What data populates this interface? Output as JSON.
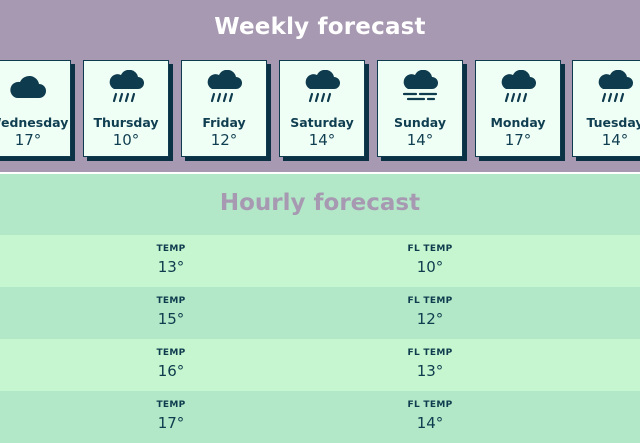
{
  "weekly": {
    "title": "Weekly forecast",
    "days": [
      {
        "name": "Wednesday",
        "temp": "17°",
        "icon": "cloud-icon"
      },
      {
        "name": "Thursday",
        "temp": "10°",
        "icon": "rain-icon"
      },
      {
        "name": "Friday",
        "temp": "12°",
        "icon": "rain-icon"
      },
      {
        "name": "Saturday",
        "temp": "14°",
        "icon": "rain-icon"
      },
      {
        "name": "Sunday",
        "temp": "14°",
        "icon": "fog-cloud-icon"
      },
      {
        "name": "Monday",
        "temp": "17°",
        "icon": "rain-icon"
      },
      {
        "name": "Tuesday",
        "temp": "14°",
        "icon": "rain-icon"
      }
    ]
  },
  "hourly": {
    "title": "Hourly forecast",
    "temp_label": "TEMP",
    "fl_label": "FL TEMP",
    "rows": [
      {
        "temp": "13°",
        "fl_temp": "10°"
      },
      {
        "temp": "15°",
        "fl_temp": "12°"
      },
      {
        "temp": "16°",
        "fl_temp": "13°"
      },
      {
        "temp": "17°",
        "fl_temp": "14°"
      }
    ]
  },
  "colors": {
    "weekly_bg": "#a799b2",
    "hourly_bg": "#b2e7c7",
    "row_alt": "#c6f6cf",
    "ink": "#0e3b4d",
    "card_bg": "#f0fff6"
  }
}
